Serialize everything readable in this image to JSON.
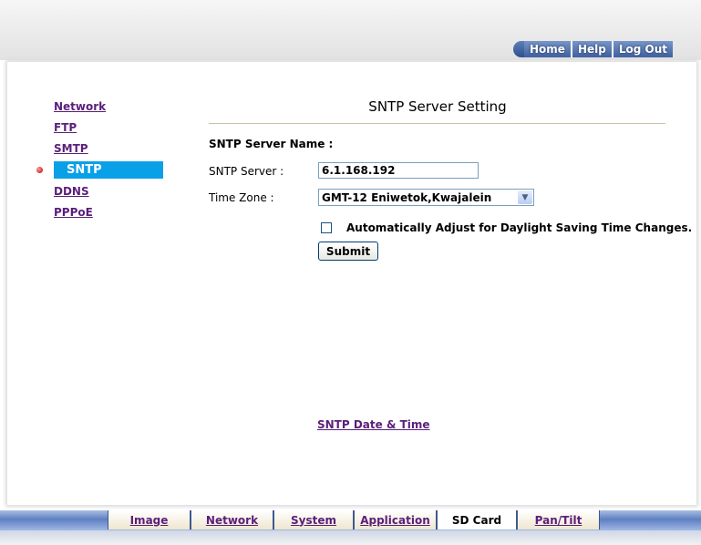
{
  "topnav": {
    "home": "Home",
    "help": "Help",
    "logout": "Log Out"
  },
  "sidebar": {
    "items": [
      {
        "label": "Network",
        "active": false
      },
      {
        "label": "FTP",
        "active": false
      },
      {
        "label": "SMTP",
        "active": false
      },
      {
        "label": "SNTP",
        "active": true
      },
      {
        "label": "DDNS",
        "active": false
      },
      {
        "label": "PPPoE",
        "active": false
      }
    ]
  },
  "main": {
    "title": "SNTP Server Setting",
    "server_name_label": "SNTP Server Name :",
    "server_label": "SNTP Server :",
    "server_value": "6.1.168.192",
    "timezone_label": "Time Zone :",
    "timezone_value": "GMT-12 Eniwetok,Kwajalein",
    "dst_label": "Automatically Adjust for Daylight Saving Time Changes.",
    "dst_checked": false,
    "submit_label": "Submit",
    "date_time_link": "SNTP Date & Time"
  },
  "bottom_tabs": [
    {
      "label": "Image",
      "current": false
    },
    {
      "label": "Network",
      "current": false
    },
    {
      "label": "System",
      "current": false
    },
    {
      "label": "Application",
      "current": false
    },
    {
      "label": "SD Card",
      "current": true
    },
    {
      "label": "Pan/Tilt",
      "current": false
    }
  ],
  "colors": {
    "active_item": "#0aa0e8",
    "link": "#5a1f7a",
    "topnav": "#3e5f9e"
  }
}
